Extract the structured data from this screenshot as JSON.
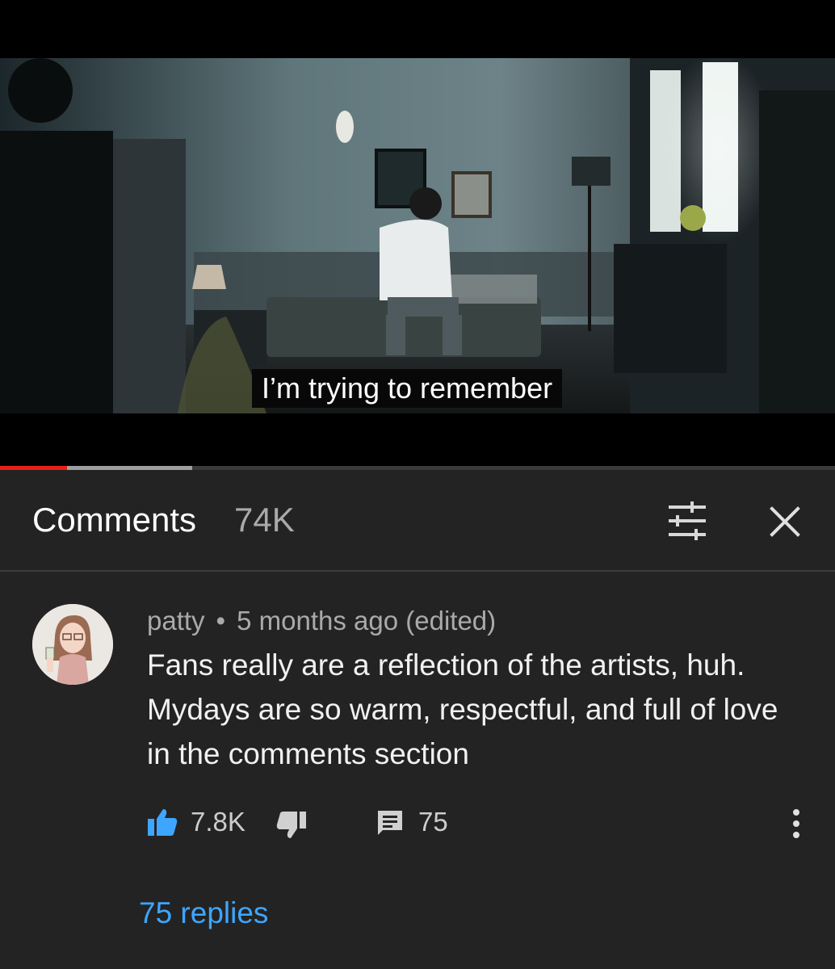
{
  "video": {
    "caption": "I’m trying to remember",
    "progress_played_fraction": 0.08,
    "progress_buffered_fraction": 0.23
  },
  "comments_panel": {
    "title": "Comments",
    "count": "74K",
    "sort_icon": "sort-sliders-icon",
    "close_icon": "close-icon"
  },
  "comment": {
    "author": "patty",
    "separator": "•",
    "time": "5 months ago (edited)",
    "text": "Fans really are a reflection of the artists, huh. Mydays are so warm, respectful, and full of love in the comments section",
    "like_count": "7.8K",
    "reply_count": "75",
    "replies_link": "75 replies"
  },
  "colors": {
    "panel_bg": "#232323",
    "like_active": "#3ea6ff",
    "link": "#3ea6ff",
    "progress_red": "#e62117"
  }
}
